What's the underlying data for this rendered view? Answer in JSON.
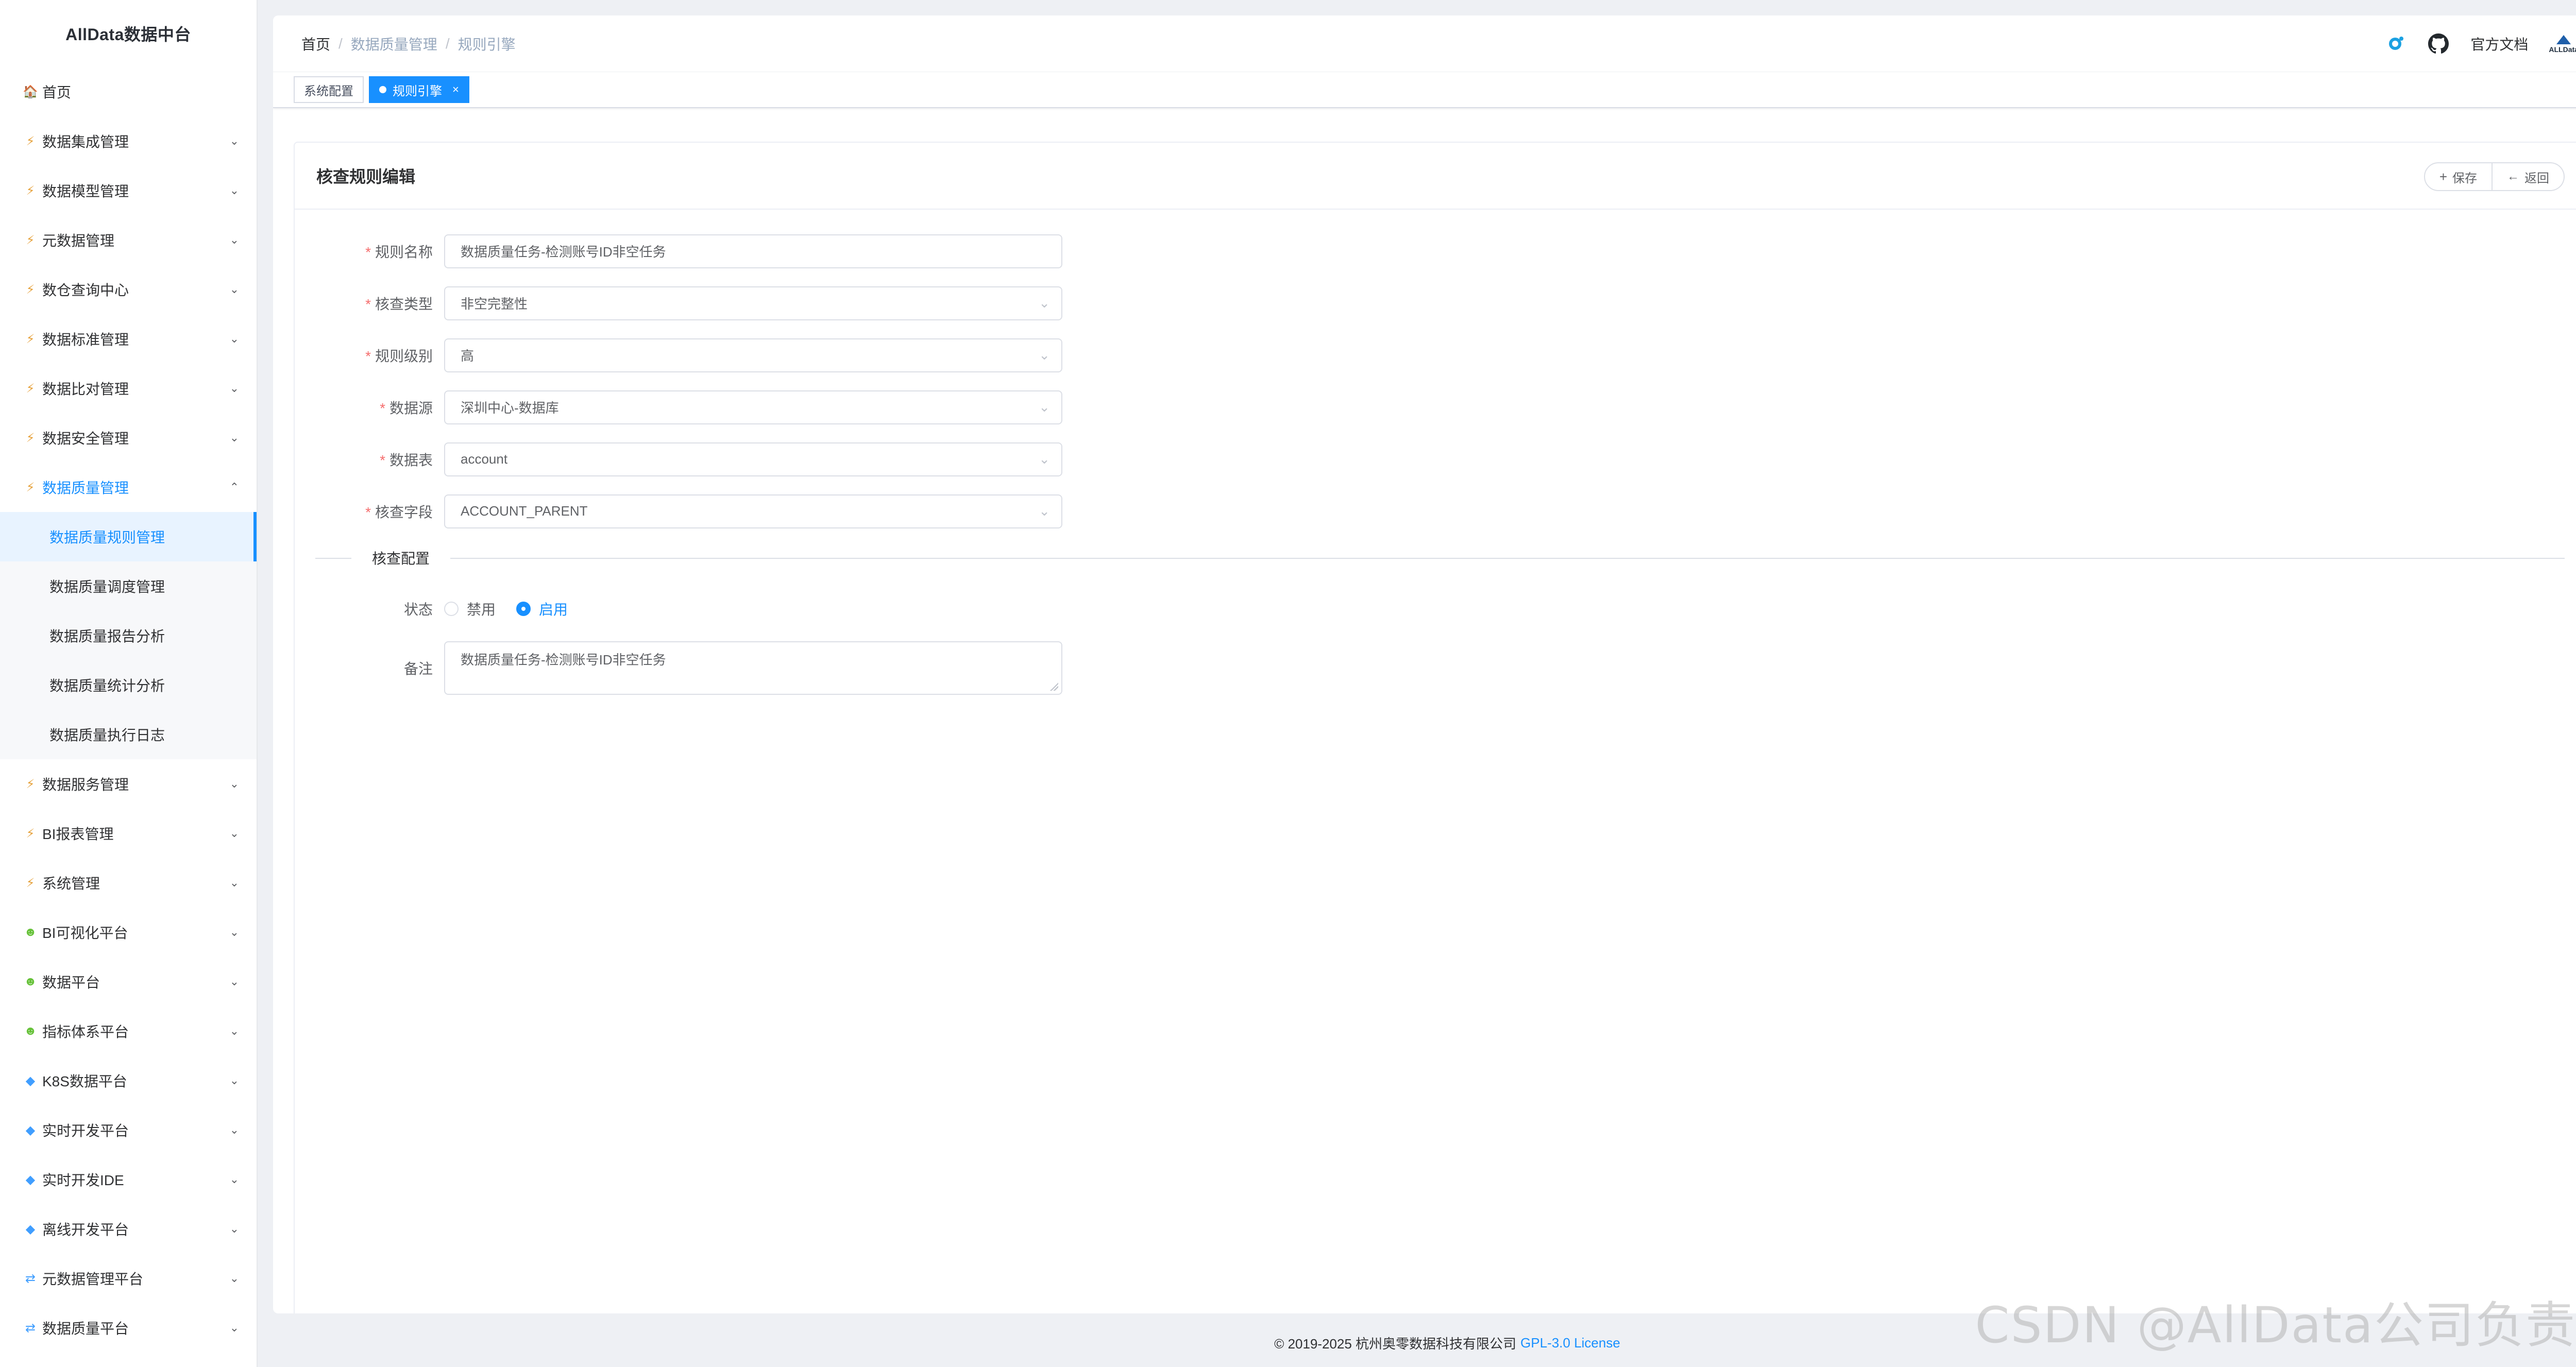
{
  "brand": {
    "name": "AllData数据中台"
  },
  "sidebar": {
    "items": [
      {
        "label": "首页",
        "icon": "home-icon"
      },
      {
        "label": "数据集成管理",
        "icon": "bolt-icon"
      },
      {
        "label": "数据模型管理",
        "icon": "bolt-icon"
      },
      {
        "label": "元数据管理",
        "icon": "bolt-icon"
      },
      {
        "label": "数仓查询中心",
        "icon": "bolt-icon"
      },
      {
        "label": "数据标准管理",
        "icon": "bolt-icon"
      },
      {
        "label": "数据比对管理",
        "icon": "bolt-icon"
      },
      {
        "label": "数据安全管理",
        "icon": "bolt-icon"
      },
      {
        "label": "数据质量管理",
        "icon": "bolt-icon"
      }
    ],
    "sub_items": [
      {
        "label": "数据质量规则管理"
      },
      {
        "label": "数据质量调度管理"
      },
      {
        "label": "数据质量报告分析"
      },
      {
        "label": "数据质量统计分析"
      },
      {
        "label": "数据质量执行日志"
      }
    ],
    "items_after": [
      {
        "label": "数据服务管理",
        "icon": "bolt-icon"
      },
      {
        "label": "BI报表管理",
        "icon": "bolt-icon"
      },
      {
        "label": "系统管理",
        "icon": "bolt-icon"
      },
      {
        "label": "BI可视化平台",
        "icon": "person-icon"
      },
      {
        "label": "数据平台",
        "icon": "person-icon"
      },
      {
        "label": "指标体系平台",
        "icon": "person-icon"
      },
      {
        "label": "K8S数据平台",
        "icon": "diamond-icon"
      },
      {
        "label": "实时开发平台",
        "icon": "diamond-icon"
      },
      {
        "label": "实时开发IDE",
        "icon": "diamond-icon"
      },
      {
        "label": "离线开发平台",
        "icon": "diamond-icon"
      },
      {
        "label": "元数据管理平台",
        "icon": "sync-icon"
      },
      {
        "label": "数据质量平台",
        "icon": "sync-icon"
      }
    ]
  },
  "topbar": {
    "breadcrumb": [
      "首页",
      "数据质量管理",
      "规则引擎"
    ],
    "docs_label": "官方文档",
    "logo_text": "ALLData"
  },
  "tags": [
    {
      "label": "系统配置"
    },
    {
      "label": "规则引擎",
      "close": "×"
    }
  ],
  "panel": {
    "title": "核查规则编辑",
    "save_label": "保存",
    "back_label": "返回"
  },
  "form": {
    "rule_name": {
      "label": "规则名称",
      "value": "数据质量任务-检测账号ID非空任务"
    },
    "check_type": {
      "label": "核查类型",
      "value": "非空完整性"
    },
    "rule_level": {
      "label": "规则级别",
      "value": "高"
    },
    "datasource": {
      "label": "数据源",
      "value": "深圳中心-数据库"
    },
    "table": {
      "label": "数据表",
      "value": "account"
    },
    "field": {
      "label": "核查字段",
      "value": "ACCOUNT_PARENT"
    },
    "section_title": "核查配置",
    "status": {
      "label": "状态",
      "disabled": "禁用",
      "enabled": "启用"
    },
    "remark": {
      "label": "备注",
      "value": "数据质量任务-检测账号ID非空任务"
    }
  },
  "footer": {
    "copyright": "© 2019-2025 杭州奥零数据科技有限公司",
    "license": "GPL-3.0 License"
  },
  "watermark": "CSDN @AllData公司负责人",
  "colors": {
    "accent": "#1890ff",
    "required": "#f56c6c"
  }
}
